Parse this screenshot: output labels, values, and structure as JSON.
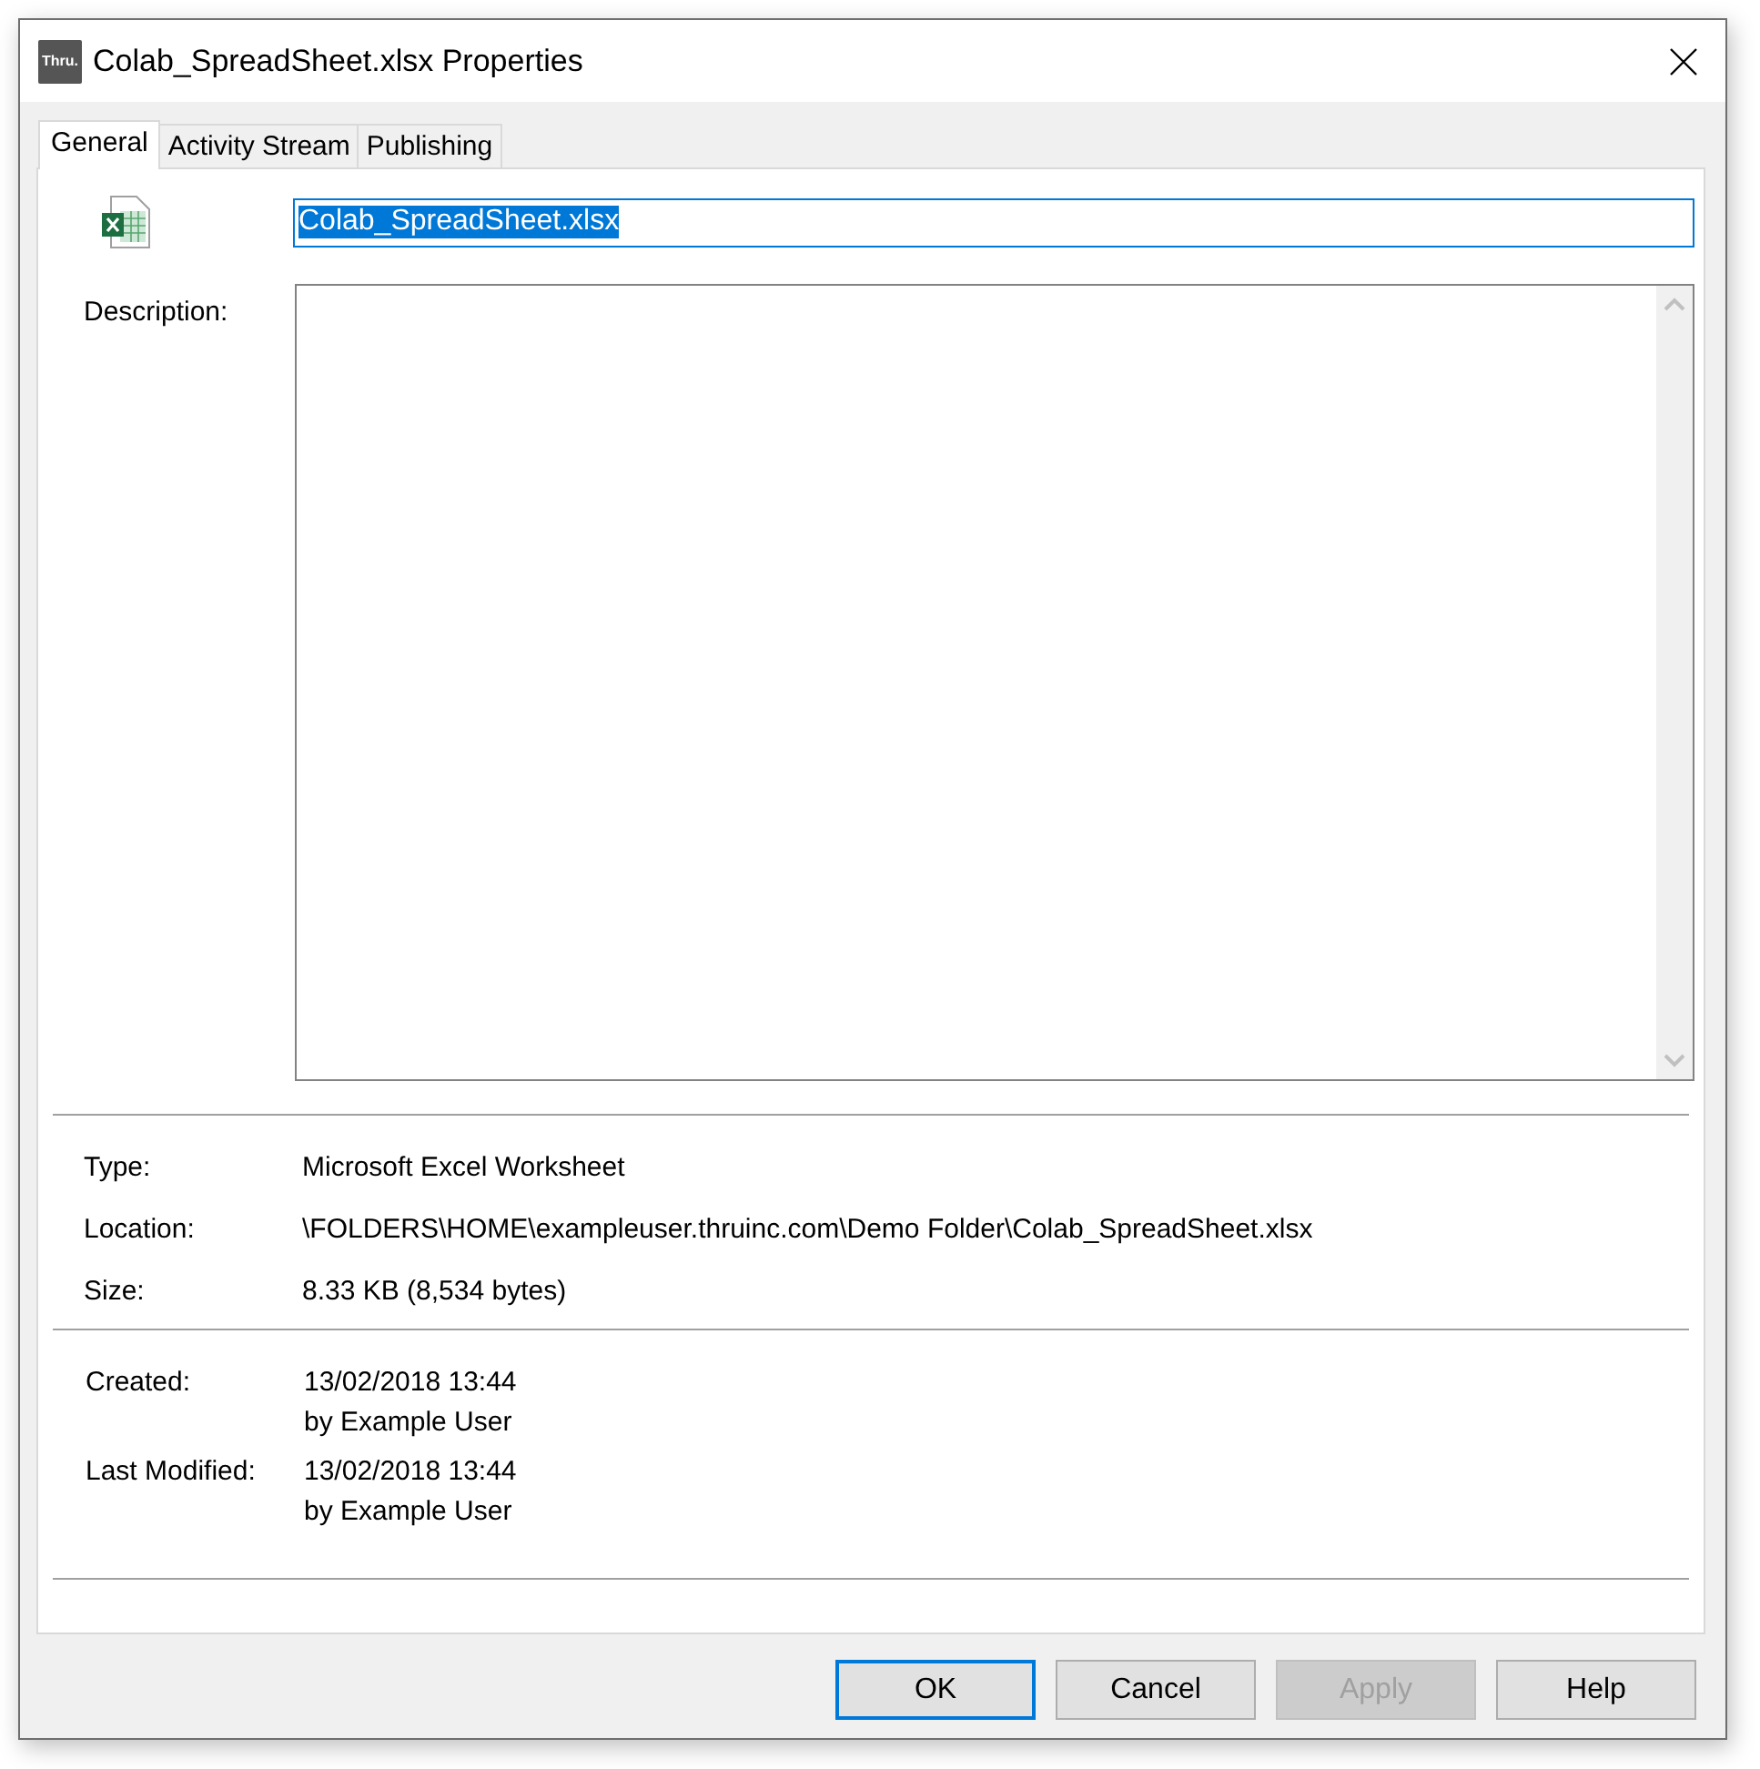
{
  "window": {
    "title": "Colab_SpreadSheet.xlsx Properties",
    "app_badge": "Thru."
  },
  "tabs": [
    {
      "label": "General",
      "selected": true
    },
    {
      "label": "Activity Stream",
      "selected": false
    },
    {
      "label": "Publishing",
      "selected": false
    }
  ],
  "name_field": {
    "value": "Colab_SpreadSheet.xlsx",
    "text_selected": true
  },
  "description": {
    "label": "Description:"
  },
  "properties": [
    {
      "label": "Type:",
      "value": "Microsoft Excel Worksheet"
    },
    {
      "label": "Location:",
      "value": "\\FOLDERS\\HOME\\exampleuser.thruinc.com\\Demo Folder\\Colab_SpreadSheet.xlsx"
    },
    {
      "label": "Size:",
      "value": "8.33 KB (8,534 bytes)"
    }
  ],
  "dates": [
    {
      "label": "Created:",
      "date": "13/02/2018 13:44",
      "by": "by Example User"
    },
    {
      "label": "Last Modified:",
      "date": "13/02/2018 13:44",
      "by": "by Example User"
    }
  ],
  "buttons": [
    {
      "label": "OK",
      "default": true,
      "disabled": false
    },
    {
      "label": "Cancel",
      "default": false,
      "disabled": false
    },
    {
      "label": "Apply",
      "default": false,
      "disabled": true
    },
    {
      "label": "Help",
      "default": false,
      "disabled": false
    }
  ]
}
